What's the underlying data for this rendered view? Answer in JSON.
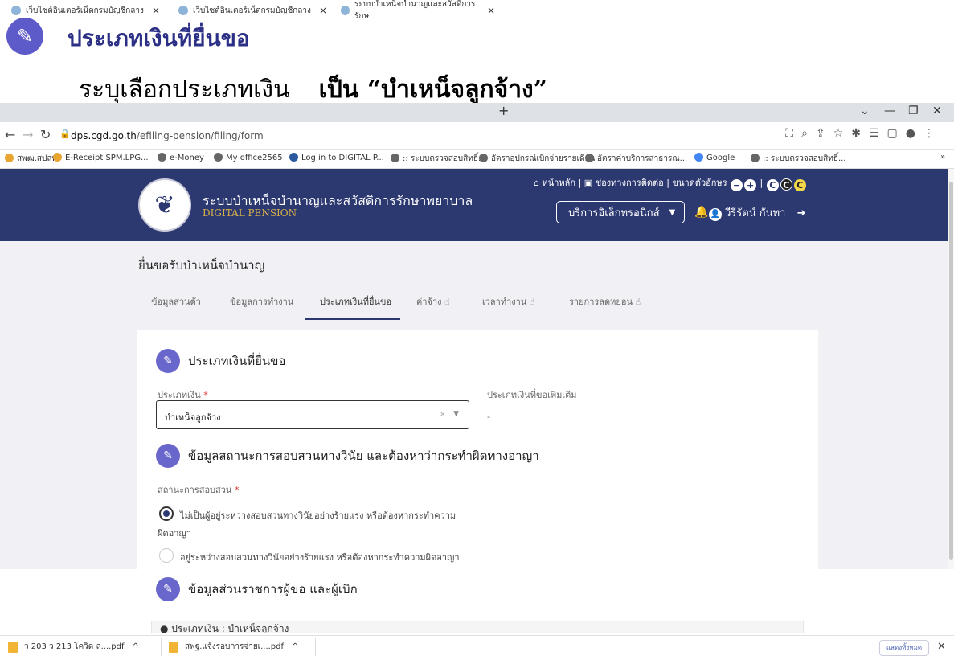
{
  "slide": {
    "title": "ประเภทเงินที่ยื่นขอ",
    "subtitle_prefix": "ระบุเลือกประเภทเงิน",
    "subtitle_bold": "เป็น “บำเหน็จลูกจ้าง”"
  },
  "browser": {
    "tabs": [
      {
        "label": "เว็บไซต์อินเตอร์เน็ตกรมบัญชีกลาง",
        "active": false
      },
      {
        "label": "เว็บไซต์อินเตอร์เน็ตกรมบัญชีกลาง",
        "active": false
      },
      {
        "label": "ระบบบำเหน็จบำนาญและสวัสดิการรักษ",
        "active": true
      }
    ],
    "new_tab": "+",
    "url_host": "dps.cgd.go.th",
    "url_path": "/efiling-pension/filing/form",
    "bookmarks": [
      "สพฒ.สปลพ",
      "E-Receipt SPM.LPG...",
      "e-Money",
      "My office2565",
      "Log in to DIGITAL P...",
      ":: ระบบตรวจสอบสิทธิ์...",
      "อัตราอุปกรณ์เบิกจ่ายรายเดือน",
      "อัตราค่าบริการสาธารณ...",
      "Google",
      ":: ระบบตรวจสอบสิทธิ์..."
    ],
    "bookmarks_more": "»"
  },
  "site": {
    "name_th": "ระบบบำเหน็จบำนาญและสวัสดิการรักษาพยาบาล",
    "name_en": "DIGITAL PENSION",
    "top_menu": {
      "home": "หน้าหลัก",
      "contact": "ช่องทางการติดต่อ",
      "font_size": "ขนาดตัวอักษร",
      "minus": "−",
      "plus": "+",
      "contrast": [
        "C",
        "C",
        "C"
      ]
    },
    "service_button": "บริการอิเล็กทรอนิกส์",
    "user_name": "วีรีรัตน์ กันทา"
  },
  "page": {
    "title": "ยื่นขอรับบำเหน็จบำนาญ",
    "tabs": [
      {
        "label": "ข้อมูลส่วนตัว",
        "active": false
      },
      {
        "label": "ข้อมูลการทำงาน",
        "active": false
      },
      {
        "label": "ประเภทเงินที่ยื่นขอ",
        "active": true
      },
      {
        "label": "ค่าจ้าง",
        "active": false
      },
      {
        "label": "เวลาทำงาน",
        "active": false
      },
      {
        "label": "รายการลดหย่อน",
        "active": false
      }
    ]
  },
  "form": {
    "section1_title": "ประเภทเงินที่ยื่นขอ",
    "money_type_label": "ประเภทเงิน",
    "required_mark": "*",
    "money_type_value": "บำเหน็จลูกจ้าง",
    "additional_label": "ประเภทเงินที่ขอเพิ่มเติม",
    "additional_value": "-",
    "section2_title": "ข้อมูลสถานะการสอบสวนทางวินัย และต้องหาว่ากระทำผิดทางอาญา",
    "inquiry_label": "สถานะการสอบสวน",
    "radio_option1_line1": "ไม่เป็นผู้อยู่ระหว่างสอบสวนทางวินัยอย่างร้ายแรง หรือต้องหากระทำความ",
    "radio_option1_line2": "ผิดอาญา",
    "radio_option2": "อยู่ระหว่างสอบสวนทางวินัยอย่างร้ายแรง หรือต้องหากระทำความผิดอาญา",
    "section3_title": "ข้อมูลส่วนราชการผู้ขอ และผู้เบิก",
    "peek_text": "ประเภทเงิน : บำเหน็จลูกจ้าง"
  },
  "downloads": {
    "items": [
      "ว 203 ว 213 โควิด ล....pdf",
      "สพฐ.แจ้งรอบการจ่ายเ....pdf"
    ],
    "show_all": "แสดงทั้งหมด",
    "close": "✕"
  }
}
